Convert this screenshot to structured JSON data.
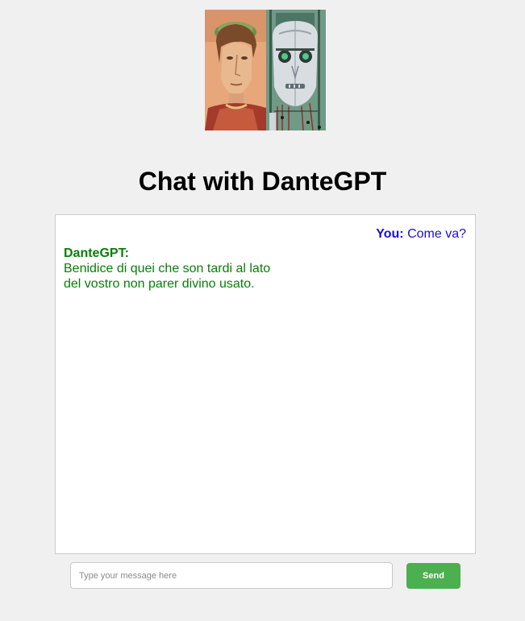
{
  "hero": {
    "icon": "dante-and-robot-portrait-icon"
  },
  "page": {
    "title": "Chat with DanteGPT"
  },
  "chat": {
    "messages": [
      {
        "sender_label": "You:",
        "text": "Come va?",
        "color": "#1a0fd6"
      },
      {
        "sender_label": "DanteGPT:",
        "text": "Benidice di quei che son tardi al lato\ndel vostro non parer divino usato.",
        "color": "#0a7d0a"
      }
    ]
  },
  "composer": {
    "placeholder": "Type your message here",
    "value": "",
    "send_label": "Send",
    "send_color": "#4caf50"
  }
}
